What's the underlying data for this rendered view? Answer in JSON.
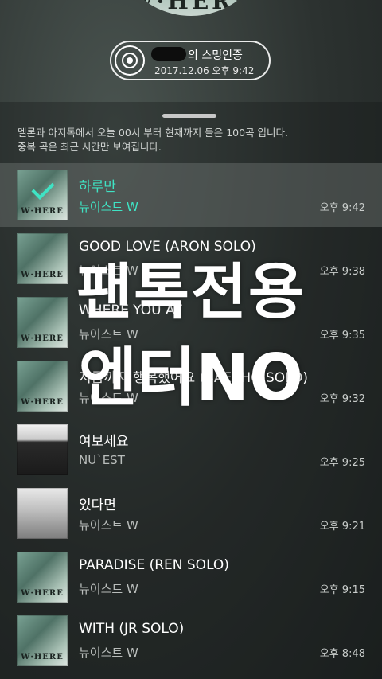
{
  "header": {
    "album_text": "W·HERE",
    "streaming_title": "의 스밍인증",
    "streaming_time": "2017.12.06 오후 9:42"
  },
  "notice": {
    "line1": "멜론과 아지톡에서 오늘 00시 부터 현재까지 들은 100곡 입니다.",
    "line2": "중복 곡은 최근 시간만 보여집니다."
  },
  "songs": [
    {
      "title": "하루만",
      "artist": "뉴이스트 W",
      "time": "오후 9:42",
      "art_text": "W·HERE"
    },
    {
      "title": "GOOD LOVE (ARON SOLO)",
      "artist": "뉴이스트 W",
      "time": "오후 9:38",
      "art_text": "W·HERE"
    },
    {
      "title": "WHERE YOU AT",
      "artist": "뉴이스트 W",
      "time": "오후 9:35",
      "art_text": "W·HERE"
    },
    {
      "title": "지금까지 행복했어요 (BAEKHO SOLO)",
      "artist": "뉴이스트 W",
      "time": "오후 9:32",
      "art_text": "W·HERE"
    },
    {
      "title": "여보세요",
      "artist": "NU`EST",
      "time": "오후 9:25",
      "art_text": ""
    },
    {
      "title": "있다면",
      "artist": "뉴이스트 W",
      "time": "오후 9:21",
      "art_text": ""
    },
    {
      "title": "PARADISE (REN SOLO)",
      "artist": "뉴이스트 W",
      "time": "오후 9:15",
      "art_text": "W·HERE"
    },
    {
      "title": "WITH (JR SOLO)",
      "artist": "뉴이스트 W",
      "time": "오후 8:48",
      "art_text": "W·HERE"
    }
  ],
  "watermark": {
    "line1": "팬톡전용",
    "line2": "엔터NO"
  },
  "colors": {
    "accent": "#3fe3c4"
  }
}
